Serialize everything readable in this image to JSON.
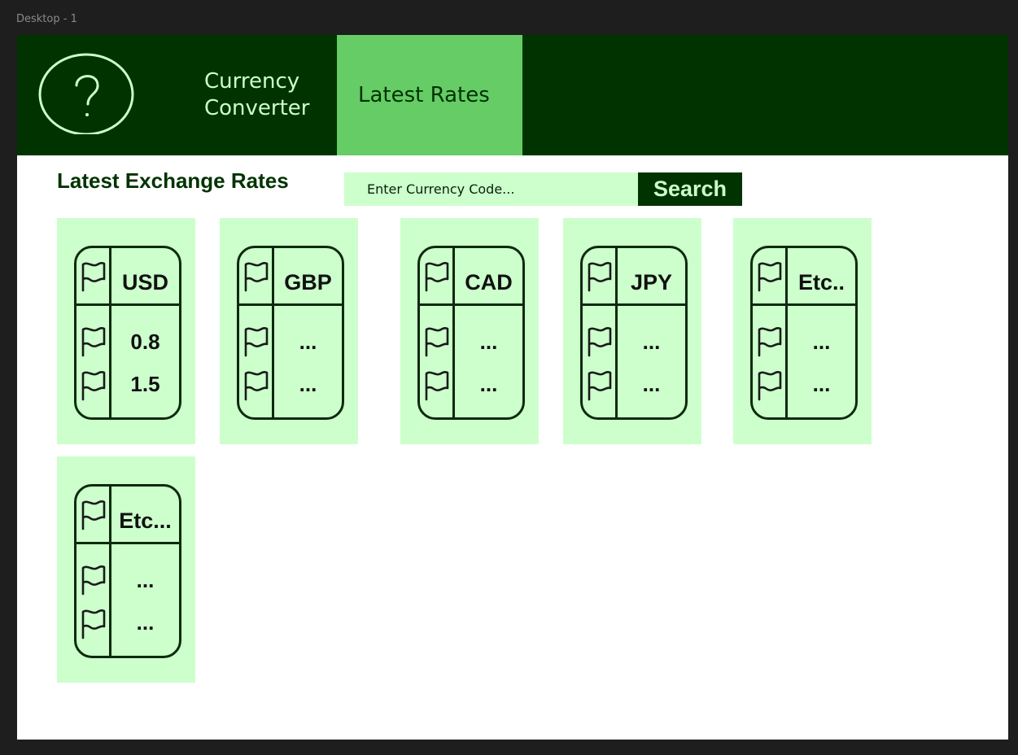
{
  "canvas": {
    "frame_label": "Desktop - 1"
  },
  "nav": {
    "brand": "Currency\nConverter",
    "active_tab": "Latest Rates",
    "logo_glyph": "?"
  },
  "main": {
    "title": "Latest Exchange Rates",
    "search": {
      "placeholder": "Enter Currency Code...",
      "button_label": "Search"
    },
    "cards": [
      {
        "code": "USD",
        "rates": [
          "0.8",
          "1.5"
        ]
      },
      {
        "code": "GBP",
        "rates": [
          "...",
          "..."
        ]
      },
      {
        "code": "CAD",
        "rates": [
          "...",
          "..."
        ]
      },
      {
        "code": "JPY",
        "rates": [
          "...",
          "..."
        ]
      },
      {
        "code": "Etc..",
        "rates": [
          "...",
          "..."
        ]
      },
      {
        "code": "Etc...",
        "rates": [
          "...",
          "..."
        ]
      }
    ]
  },
  "colors": {
    "nav_bg": "#003300",
    "tab_active": "#66cc66",
    "card_bg": "#ccffcc",
    "text_light": "#ccffcc",
    "text_dark": "#003300"
  },
  "icons": {
    "logo": "question-circle-icon",
    "flag": "flag-icon"
  }
}
